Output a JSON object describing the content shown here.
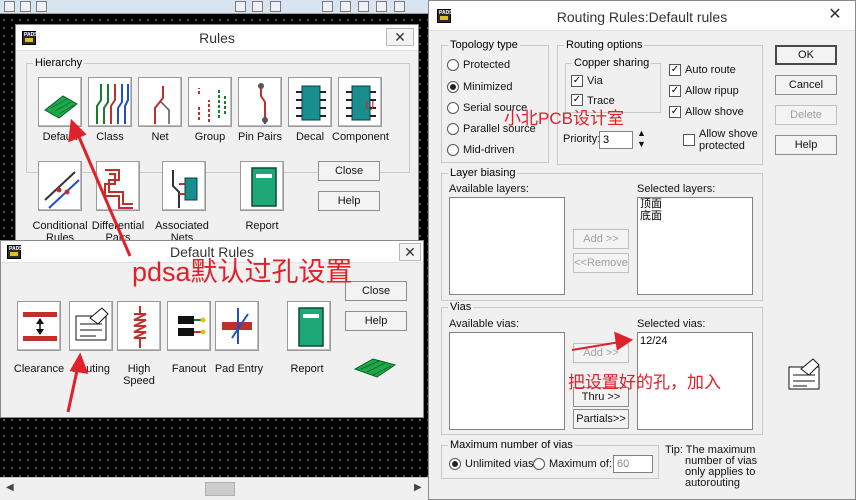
{
  "rules_window": {
    "title": "Rules",
    "hierarchy_label": "Hierarchy",
    "icons": [
      {
        "label": "Default",
        "icon": "default-board-icon"
      },
      {
        "label": "Class",
        "icon": "class-icon"
      },
      {
        "label": "Net",
        "icon": "net-icon"
      },
      {
        "label": "Group",
        "icon": "group-icon"
      },
      {
        "label": "Pin Pairs",
        "icon": "pin-pairs-icon"
      },
      {
        "label": "Decal",
        "icon": "decal-icon"
      },
      {
        "label": "Component",
        "icon": "component-icon"
      },
      {
        "label_line1": "Conditional",
        "label_line2": "Rules",
        "icon": "conditional-rules-icon"
      },
      {
        "label_line1": "Differential",
        "label_line2": "Pairs",
        "icon": "differential-pairs-icon"
      },
      {
        "label_line1": "Associated",
        "label_line2": "Nets",
        "icon": "associated-nets-icon"
      },
      {
        "label": "Report",
        "icon": "report-icon"
      }
    ],
    "close_label": "Close",
    "help_label": "Help"
  },
  "default_rules_window": {
    "title": "Default Rules",
    "icons": [
      {
        "label": "Clearance",
        "icon": "clearance-icon"
      },
      {
        "label": "Routing",
        "icon": "routing-icon"
      },
      {
        "label_line1": "High",
        "label_line2": "Speed",
        "icon": "high-speed-icon"
      },
      {
        "label": "Fanout",
        "icon": "fanout-icon"
      },
      {
        "label": "Pad Entry",
        "icon": "pad-entry-icon"
      },
      {
        "label": "Report",
        "icon": "report-icon"
      }
    ],
    "close_label": "Close",
    "help_label": "Help"
  },
  "routing_rules": {
    "title": "Routing Rules:Default rules",
    "topology": {
      "label": "Topology type",
      "options": [
        "Protected",
        "Minimized",
        "Serial source",
        "Parallel source",
        "Mid-driven"
      ],
      "selected": "Minimized"
    },
    "routing_options": {
      "label": "Routing options",
      "copper_sharing_label": "Copper sharing",
      "via_label": "Via",
      "via_checked": true,
      "trace_label": "Trace",
      "trace_checked": true,
      "priority_label": "Priority:",
      "priority_value": "3",
      "auto_route_label": "Auto route",
      "auto_route_checked": true,
      "allow_ripup_label": "Allow ripup",
      "allow_ripup_checked": true,
      "allow_shove_label": "Allow shove",
      "allow_shove_checked": true,
      "allow_shove_protected_line1": "Allow shove",
      "allow_shove_protected_line2": "protected",
      "allow_shove_protected_checked": false
    },
    "layer_biasing": {
      "label": "Layer biasing",
      "available_label": "Available layers:",
      "selected_label": "Selected layers:",
      "selected_items": [
        "顶面",
        "底面"
      ],
      "add_label": "Add >>",
      "remove_label": "<<Remove"
    },
    "vias": {
      "label": "Vias",
      "available_label": "Available vias:",
      "selected_label": "Selected vias:",
      "selected_items": [
        "12/24"
      ],
      "add_label": "Add >>",
      "thru_label": "Thru >>",
      "partials_label": "Partials>>"
    },
    "max_vias": {
      "label": "Maximum number of vias",
      "unlimited_label": "Unlimited vias",
      "maximum_label": "Maximum of:",
      "maximum_value": "60",
      "selected": "Unlimited vias"
    },
    "tip_lines": [
      "Tip: The maximum",
      "number of vias",
      "only applies to",
      "autorouting"
    ],
    "buttons": {
      "ok": "OK",
      "cancel": "Cancel",
      "delete": "Delete",
      "help": "Help"
    }
  },
  "annotations": {
    "watermark": "小北PCB设计室",
    "pdsa_note": "pdsa默认过孔设置",
    "add_note": "把设置好的孔，加入"
  },
  "colors": {
    "annotation_red": "#e0202a",
    "pads_green": "#1ea84a"
  }
}
